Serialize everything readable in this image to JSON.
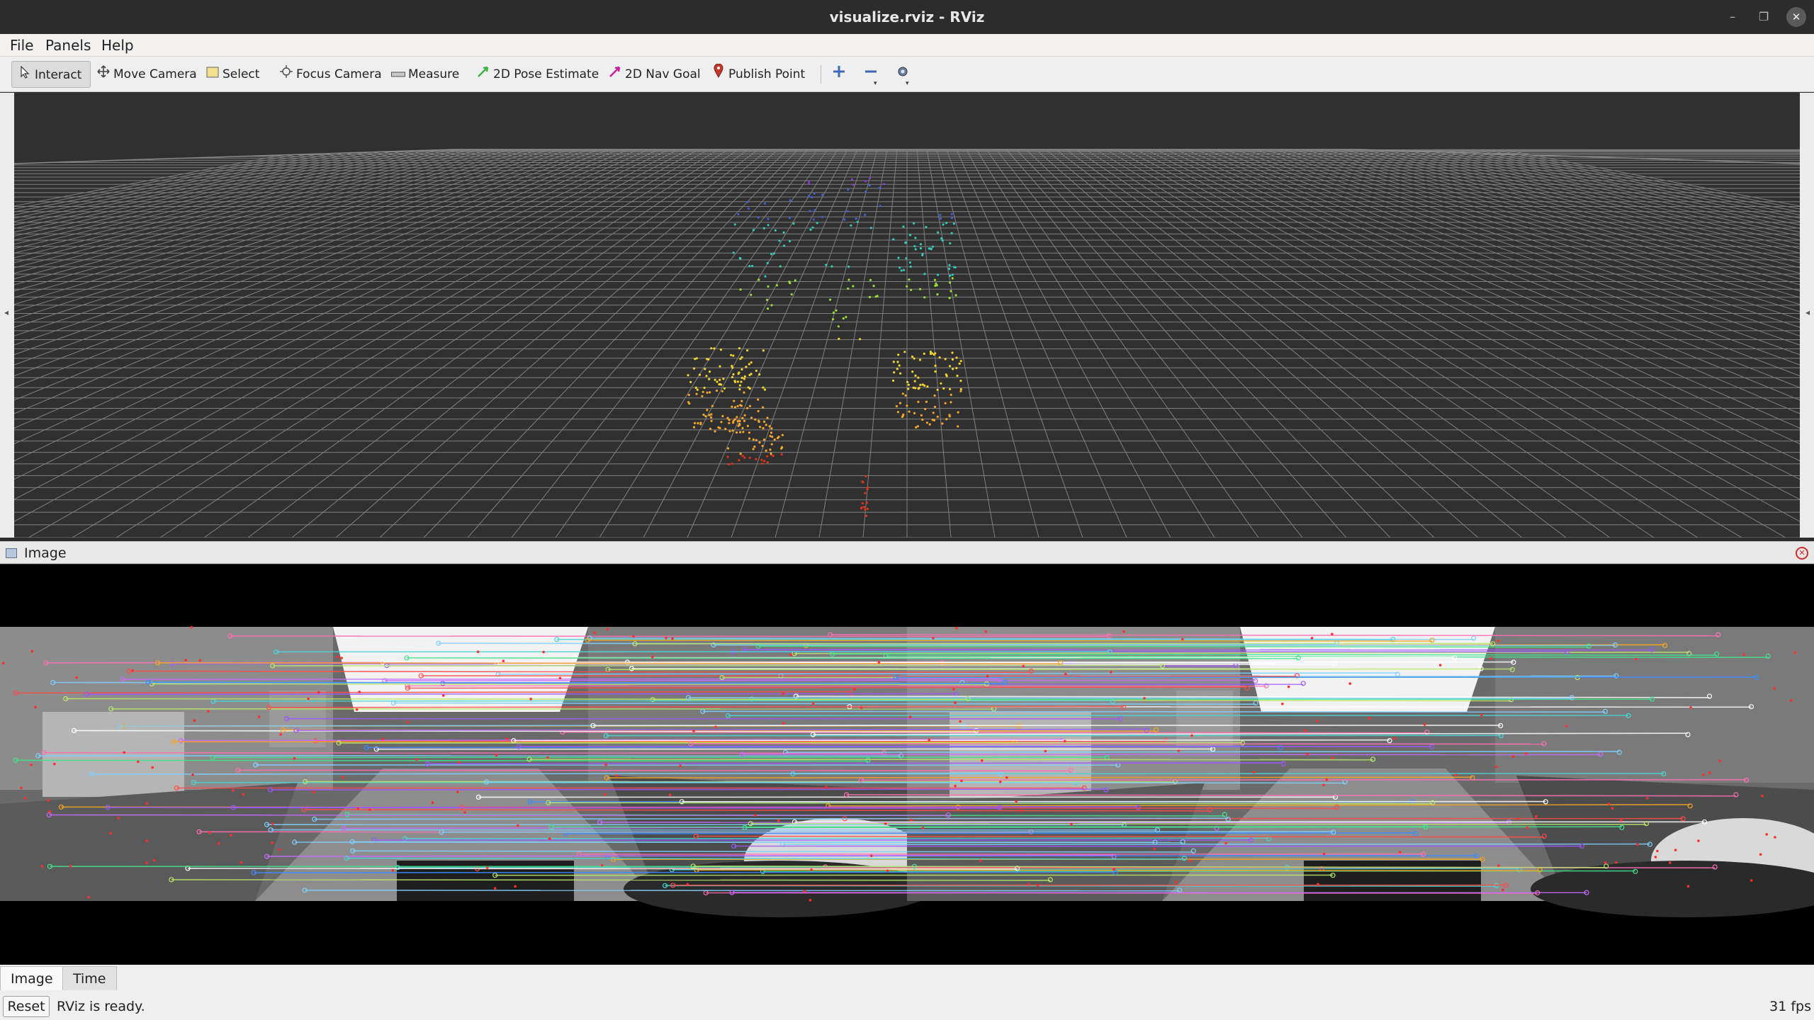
{
  "window": {
    "title": "visualize.rviz - RViz",
    "controls": {
      "minimize": "–",
      "maximize": "❐",
      "close": "✕"
    }
  },
  "menubar": {
    "items": [
      {
        "label": "File"
      },
      {
        "label": "Panels"
      },
      {
        "label": "Help"
      }
    ]
  },
  "toolbar": {
    "tools": [
      {
        "label": "Interact",
        "icon": "cursor-icon",
        "active": true
      },
      {
        "label": "Move Camera",
        "icon": "move-icon"
      },
      {
        "label": "Select",
        "icon": "select-box-icon"
      },
      {
        "label": "Focus Camera",
        "icon": "focus-icon"
      },
      {
        "label": "Measure",
        "icon": "ruler-icon"
      },
      {
        "label": "2D Pose Estimate",
        "icon": "green-arrow-icon"
      },
      {
        "label": "2D Nav Goal",
        "icon": "pink-arrow-icon"
      },
      {
        "label": "Publish Point",
        "icon": "map-pin-icon"
      }
    ],
    "icon_buttons": [
      {
        "icon": "add-tool-icon"
      },
      {
        "icon": "remove-tool-icon"
      },
      {
        "icon": "camera-type-icon"
      }
    ]
  },
  "view3d": {
    "background": "#303030",
    "grid_color": "#9a9a9a"
  },
  "image_panel": {
    "title": "Image"
  },
  "bottom_tabs": [
    {
      "label": "Image",
      "active": true
    },
    {
      "label": "Time",
      "active": false
    }
  ],
  "statusbar": {
    "reset_label": "Reset",
    "status": "RViz is ready.",
    "fps": "31 fps"
  }
}
